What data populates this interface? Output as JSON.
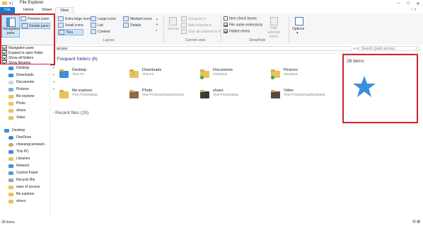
{
  "window": {
    "title": "File Explorer"
  },
  "tabs": [
    "File",
    "Home",
    "Share",
    "View"
  ],
  "ribbon": {
    "panes": {
      "navigation_pane": "Navigation pane",
      "preview_pane": "Preview pane",
      "details_pane": "Details pane"
    },
    "layout": {
      "extra_large_icons": "Extra large icons",
      "large_icons": "Large icons",
      "medium_icons": "Medium icons",
      "small_icons": "Small icons",
      "list": "List",
      "details": "Details",
      "tiles": "Tiles",
      "content": "Content",
      "group_label": "Layout"
    },
    "current_view": {
      "sort_by": "Sort by",
      "group_by": "Group by",
      "add_columns": "Add columns",
      "size_all_columns": "Size all columns to fit",
      "group_label": "Current view"
    },
    "show_hide": {
      "item_check_boxes": "Item check boxes",
      "file_name_extensions": "File name extensions",
      "hidden_items": "Hidden items",
      "hide_selected_items": "Hide selected items",
      "group_label": "Show/hide"
    },
    "options": "Options"
  },
  "nav_menu": [
    "Navigation pane",
    "Expand to open folder",
    "Show all folders",
    "Show libraries"
  ],
  "address": {
    "path": "access",
    "search_placeholder": "Search Quick access"
  },
  "sidebar": {
    "items": [
      "Desktop",
      "Downloads",
      "Documents",
      "Pictures",
      "file explorer",
      "Photo",
      "shoes",
      "Video",
      "Desktop",
      "OneDrive",
      "chavangi peswani",
      "This PC",
      "Libraries",
      "Network",
      "Control Panel",
      "Recycle Bin",
      "ease of access",
      "file explorer",
      "shoes"
    ]
  },
  "main": {
    "frequent_header": "Frequent folders (8)",
    "folders": [
      {
        "name": "Desktop",
        "sub": "This PC"
      },
      {
        "name": "Downloads",
        "sub": "This PC"
      },
      {
        "name": "Documents",
        "sub": "OneDrive"
      },
      {
        "name": "Pictures",
        "sub": "OneDrive"
      },
      {
        "name": "file explorer",
        "sub": "This PC\\Desktop"
      },
      {
        "name": "Photo",
        "sub": "This PC\\Downloads\\Shareit"
      },
      {
        "name": "shoes",
        "sub": "This PC\\Desktop"
      },
      {
        "name": "Video",
        "sub": "This PC\\Downloads\\Shareit"
      }
    ],
    "recent_header": "Recent files (20)"
  },
  "details_pane": {
    "count": "28 items"
  },
  "status_bar": {
    "count": "28 items"
  },
  "colors": {
    "accent": "#1979ca",
    "highlight": "#d0232a",
    "star": "#3b8fd9"
  }
}
